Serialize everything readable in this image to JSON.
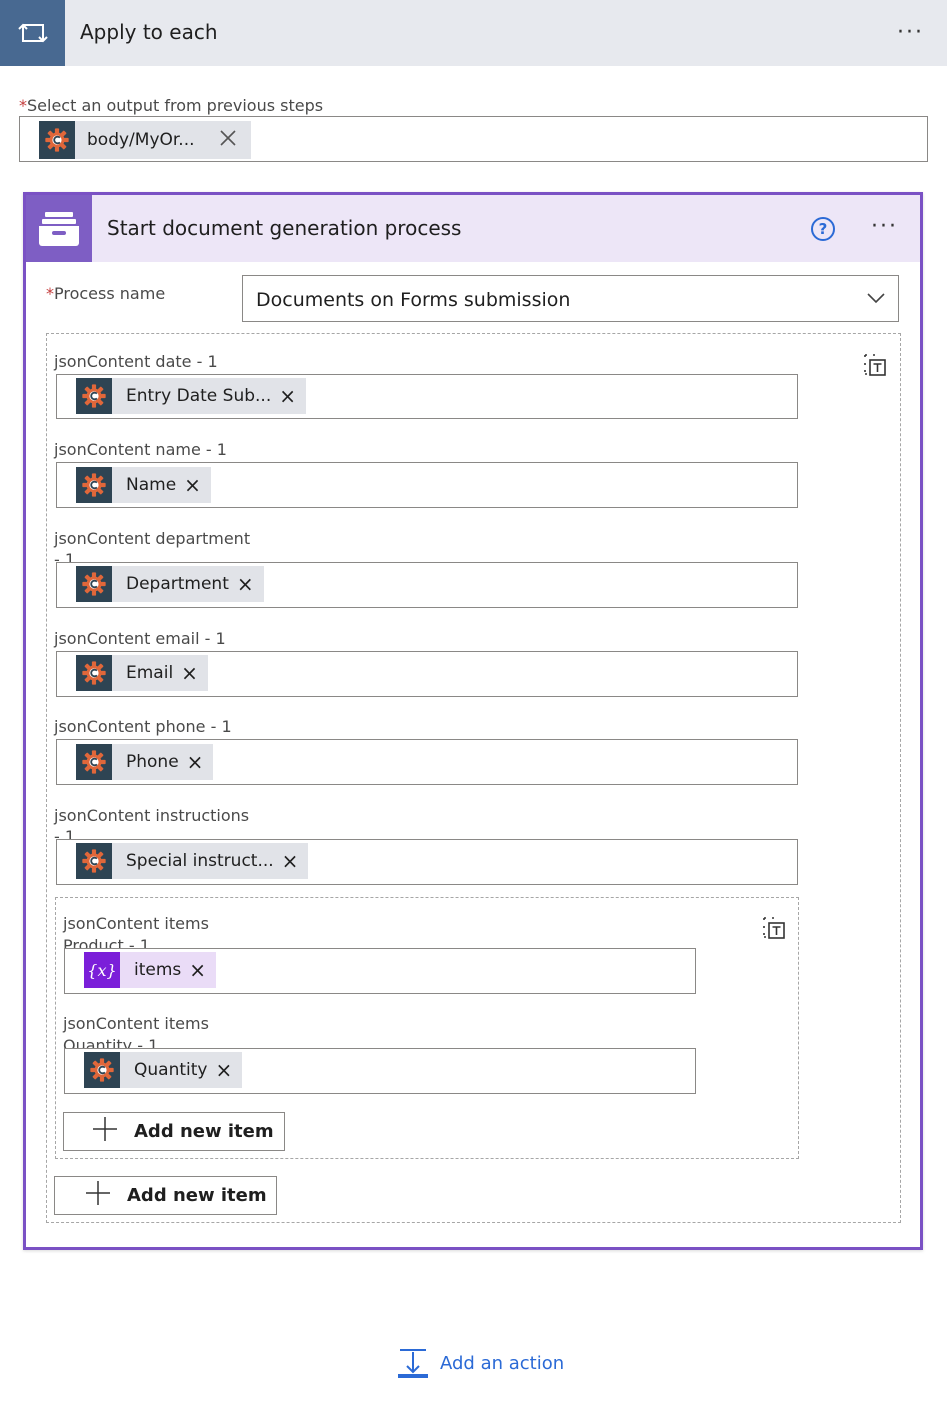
{
  "loop": {
    "title": "Apply to each",
    "more": "···",
    "select_label": "Select an output from previous steps",
    "select_token": "body/MyOr...",
    "required_mark": "*"
  },
  "action": {
    "title": "Start document generation process",
    "help": "?",
    "more": "···",
    "process_label": "Process name",
    "process_value": "Documents on Forms submission",
    "fields": [
      {
        "label": "jsonContent date - 1",
        "token": "Entry Date Sub...",
        "x": "×"
      },
      {
        "label": "jsonContent name - 1",
        "token": "Name",
        "x": "×"
      },
      {
        "label": "jsonContent department",
        "label2": "- 1",
        "token": "Department",
        "x": "×"
      },
      {
        "label": "jsonContent email - 1",
        "token": "Email",
        "x": "×"
      },
      {
        "label": "jsonContent phone - 1",
        "token": "Phone",
        "x": "×"
      },
      {
        "label": "jsonContent instructions",
        "label2": "- 1",
        "token": "Special instruct...",
        "x": "×"
      }
    ],
    "items": {
      "product_label": "jsonContent items",
      "product_label2": "Product - 1",
      "product_token": "items",
      "quantity_label": "jsonContent items",
      "quantity_label2": "Quantity - 1",
      "quantity_token": "Quantity",
      "x": "×",
      "var_glyph": "{x}",
      "add_item": "Add new item"
    },
    "add_item": "Add new item"
  },
  "footer": {
    "add_action": "Add an action"
  },
  "colors": {
    "loop_header_bg": "#e7e9ee",
    "loop_icon_bg": "#486991",
    "card_border": "#7a51c4",
    "card_header_bg": "#ede6f7",
    "card_icon_bg": "#7e5ec4",
    "token_bg": "#e1e3e8",
    "token_icon_bg": "#2e4453",
    "token_gear": "#e0673a",
    "variable_bg": "#eadcf7",
    "variable_icon_bg": "#7b1fd9",
    "link_blue": "#2b6ad6",
    "required_red": "#c43c3c"
  },
  "icons": {
    "loop": "loop-icon",
    "connector": "connector-gear-icon",
    "archive": "archive-drawer-icon",
    "help": "help-circle-icon",
    "more": "more-dots-icon",
    "chevron": "chevron-down-icon",
    "close": "close-icon",
    "array_transform": "array-transform-icon",
    "plus": "plus-icon",
    "add_action": "add-action-icon"
  }
}
